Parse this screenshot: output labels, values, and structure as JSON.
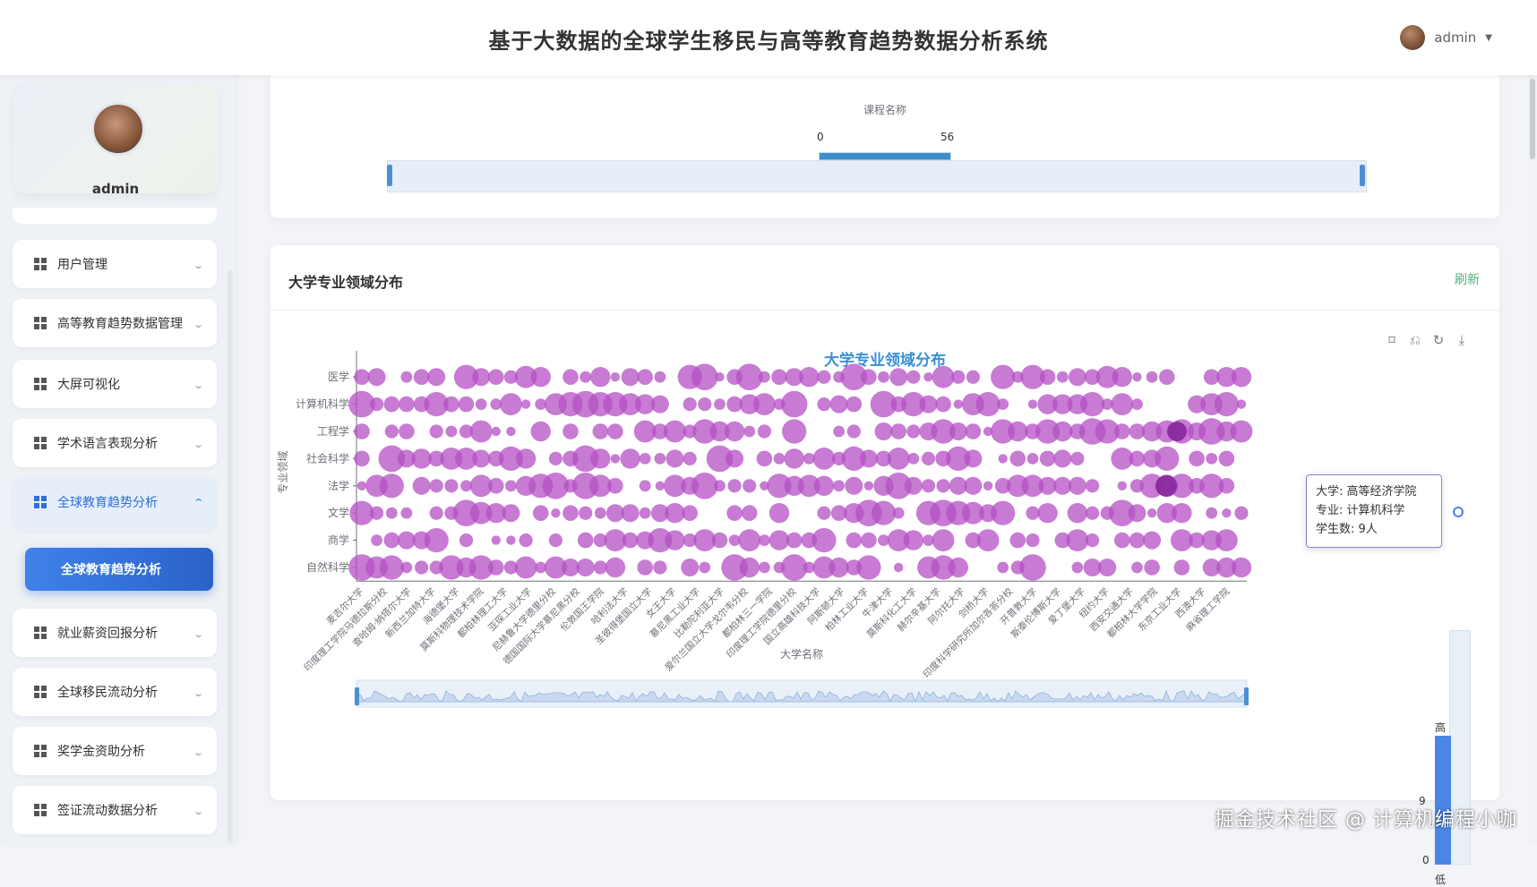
{
  "app": {
    "title": "基于大数据的全球学生移民与高等教育趋势数据分析系统"
  },
  "user": {
    "name": "admin",
    "caret": "▼"
  },
  "sidebar": {
    "profile_name": "admin",
    "items": [
      {
        "label": "用户管理",
        "icon": "grid-icon",
        "active": false
      },
      {
        "label": "高等教育趋势数据管理",
        "icon": "grid-icon",
        "active": false
      },
      {
        "label": "大屏可视化",
        "icon": "grid-icon",
        "active": false
      },
      {
        "label": "学术语言表现分析",
        "icon": "grid-icon",
        "active": false
      },
      {
        "label": "全球教育趋势分析",
        "icon": "grid-icon",
        "active": true
      },
      {
        "label": "就业薪资回报分析",
        "icon": "grid-icon",
        "active": false
      },
      {
        "label": "全球移民流动分析",
        "icon": "grid-icon",
        "active": false
      },
      {
        "label": "奖学金资助分析",
        "icon": "grid-icon",
        "active": false
      },
      {
        "label": "签证流动数据分析",
        "icon": "grid-icon",
        "active": false
      }
    ],
    "submenu_active": "全球教育趋势分析"
  },
  "top_card": {
    "xlabel": "课程名称",
    "range_start": "0",
    "range_end": "56"
  },
  "main_card": {
    "title": "大学专业领域分布",
    "refresh": "刷新",
    "toolbox": [
      "zoom-icon",
      "zoom-reset-icon",
      "restore-icon",
      "download-icon"
    ]
  },
  "chart_data": {
    "type": "scatter",
    "title": "大学专业领域分布",
    "xlabel": "大学名称",
    "ylabel": "专业领域",
    "y_categories": [
      "医学",
      "计算机科学",
      "工程学",
      "社会科学",
      "法学",
      "文学",
      "商学",
      "自然科学"
    ],
    "x_tick_labels": [
      "麦吉尔大学",
      "印度理工学院马德拉斯分校",
      "查哈姆·纳塔尔大学",
      "新西兰加特大学",
      "海德堡大学",
      "莫斯科物理技术学院",
      "都柏林理工大学",
      "亚琛工业大学",
      "尼赫鲁大学德里分校",
      "德国国际大学慕尼黑分校",
      "伦敦国王学院",
      "哈利法大学",
      "圣彼得堡国立大学",
      "女王大学",
      "慕尼黑工业大学",
      "比勒陀利亚大学",
      "爱尔兰国立大学戈尔韦分校",
      "都柏林三一学院",
      "印度理工学院德里分校",
      "国立高雄科技大学",
      "阿斯顿大学",
      "柏林工业大学",
      "牛津大学",
      "莫斯科化工大学",
      "赫尔辛基大学",
      "阿尔托大学",
      "剑桥大学",
      "印度科学研究所加尔各答分校",
      "开普敦大学",
      "斯泰伦博斯大学",
      "爱丁堡大学",
      "纽约大学",
      "西安交通大学",
      "都柏林大学学院",
      "东京工业大学",
      "西澳大学",
      "麻省理工学院"
    ],
    "value_name": "学生数",
    "visual_map": {
      "min": 0,
      "max": 9,
      "high_label": "高",
      "low_label": "低",
      "max_label": "9",
      "min_label": "0"
    },
    "tooltip": {
      "university": "大学: 高等经济学院",
      "major": "专业: 计算机科学",
      "students": "学生数: 9人"
    },
    "dot_color": "#b44fc4",
    "highlight_color": "#8a2a9e",
    "note": "约185所大学×8个领域，气泡大小=学生数(0-9)"
  },
  "watermark": "掘金技术社区 @ 计算机编程小咖"
}
